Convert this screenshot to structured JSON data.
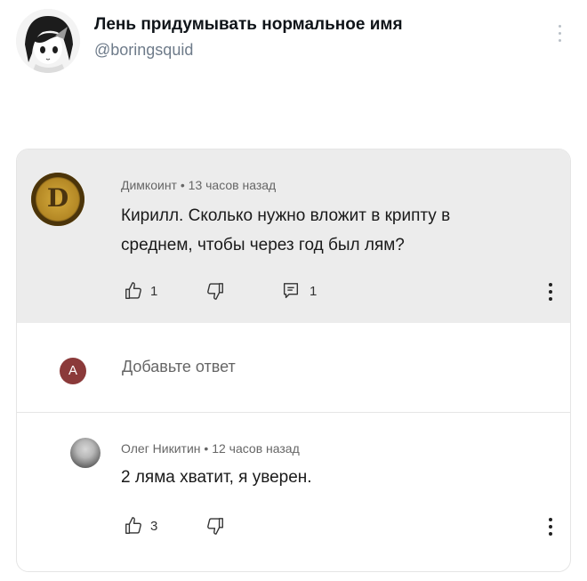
{
  "tweet": {
    "display_name": "Лень придумывать нормальное имя",
    "handle": "@boringsquid"
  },
  "screenshot": {
    "top_comment": {
      "author": "Димкоинт",
      "time": "13 часов назад",
      "avatar_letter": "D",
      "text_line1": "Кирилл. Сколько нужно вложит в крипту в",
      "text_line2": "среднем, чтобы через год был лям?",
      "likes": "1",
      "replies": "1"
    },
    "reply_input": {
      "avatar_letter": "А",
      "placeholder": "Добавьте ответ"
    },
    "reply": {
      "author": "Олег Никитин",
      "time": "12 часов назад",
      "text": "2 ляма хватит, я уверен.",
      "likes": "3"
    }
  },
  "icons": {
    "like": "thumbs-up-icon",
    "dislike": "thumbs-down-icon",
    "reply": "reply-icon",
    "more": "more-vertical-icon"
  },
  "colors": {
    "comment_bg": "#ececec",
    "coin_gold": "#c39a33",
    "reply_avatar_bg": "#8b3a3a",
    "handle_gray": "#6e7b8a"
  }
}
